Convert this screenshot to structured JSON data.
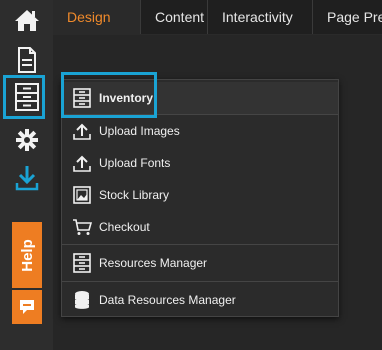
{
  "tabs": [
    {
      "label": "Design"
    },
    {
      "label": "Content"
    },
    {
      "label": "Interactivity"
    },
    {
      "label": "Page Pre"
    }
  ],
  "sidebar": {
    "help_label": "Help",
    "icons": [
      "home-icon",
      "page-icon",
      "inventory-icon",
      "settings-gear-icon",
      "download-icon",
      "chat-icon"
    ]
  },
  "menu": {
    "items": [
      {
        "label": "Inventory",
        "icon": "inventory-icon"
      },
      {
        "label": "Upload Images",
        "icon": "upload-icon"
      },
      {
        "label": "Upload Fonts",
        "icon": "upload-icon"
      },
      {
        "label": "Stock Library",
        "icon": "image-icon"
      },
      {
        "label": "Checkout",
        "icon": "cart-icon"
      },
      {
        "label": "Resources Manager",
        "icon": "cabinet-icon"
      },
      {
        "label": "Data Resources Manager",
        "icon": "database-icon"
      }
    ]
  },
  "colors": {
    "accent": "#f08a2b",
    "highlight": "#1aa3d4",
    "help": "#ee7d22"
  }
}
